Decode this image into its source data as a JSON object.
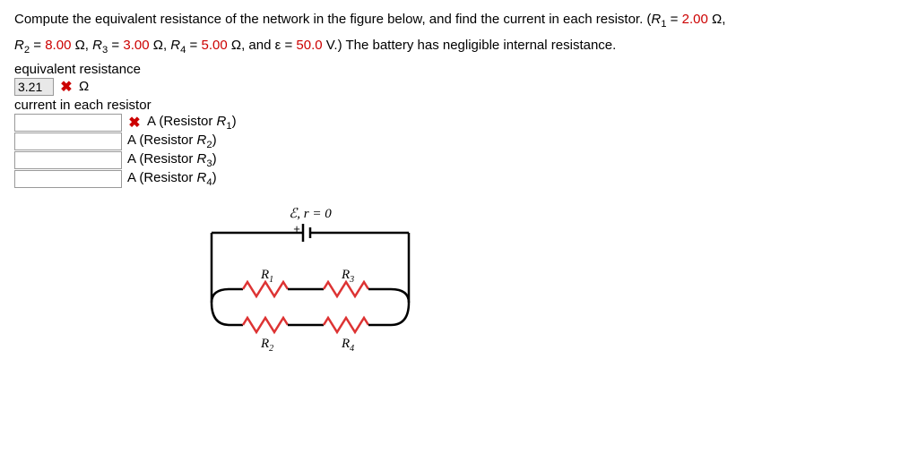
{
  "problem": {
    "line1_a": "Compute the equivalent resistance of the network in the figure below, and find the current in each resistor. (",
    "line1_R1": "R",
    "line1_R1sub": "1",
    "line1_b": " = ",
    "line1_R1val": "2.00",
    "line1_c": " Ω,",
    "line2_R2": "R",
    "line2_R2sub": "2",
    "line2_a": " = ",
    "line2_R2val": "8.00",
    "line2_b": " Ω, ",
    "line2_R3": "R",
    "line2_R3sub": "3",
    "line2_c": " = ",
    "line2_R3val": "3.00",
    "line2_d": " Ω, ",
    "line2_R4": "R",
    "line2_R4sub": "4",
    "line2_e": " = ",
    "line2_R4val": "5.00",
    "line2_f": " Ω, and ε = ",
    "line2_emfval": "50.0",
    "line2_g": " V.) The battery has negligible internal resistance."
  },
  "sections": {
    "eq_res_label": "equivalent resistance",
    "eq_res_value": "3.21",
    "eq_res_unit": "Ω",
    "cur_label": "current in each resistor",
    "rows": [
      {
        "unit": "A (Resistor ",
        "r": "R",
        "sub": "1",
        "close": ")"
      },
      {
        "unit": "A (Resistor ",
        "r": "R",
        "sub": "2",
        "close": ")"
      },
      {
        "unit": "A (Resistor ",
        "r": "R",
        "sub": "3",
        "close": ")"
      },
      {
        "unit": "A (Resistor ",
        "r": "R",
        "sub": "4",
        "close": ")"
      }
    ]
  },
  "circuit": {
    "top_label": "ℰ,  r = 0",
    "plus": "+",
    "R1": "R",
    "R1s": "1",
    "R2": "R",
    "R2s": "2",
    "R3": "R",
    "R3s": "3",
    "R4": "R",
    "R4s": "4"
  }
}
